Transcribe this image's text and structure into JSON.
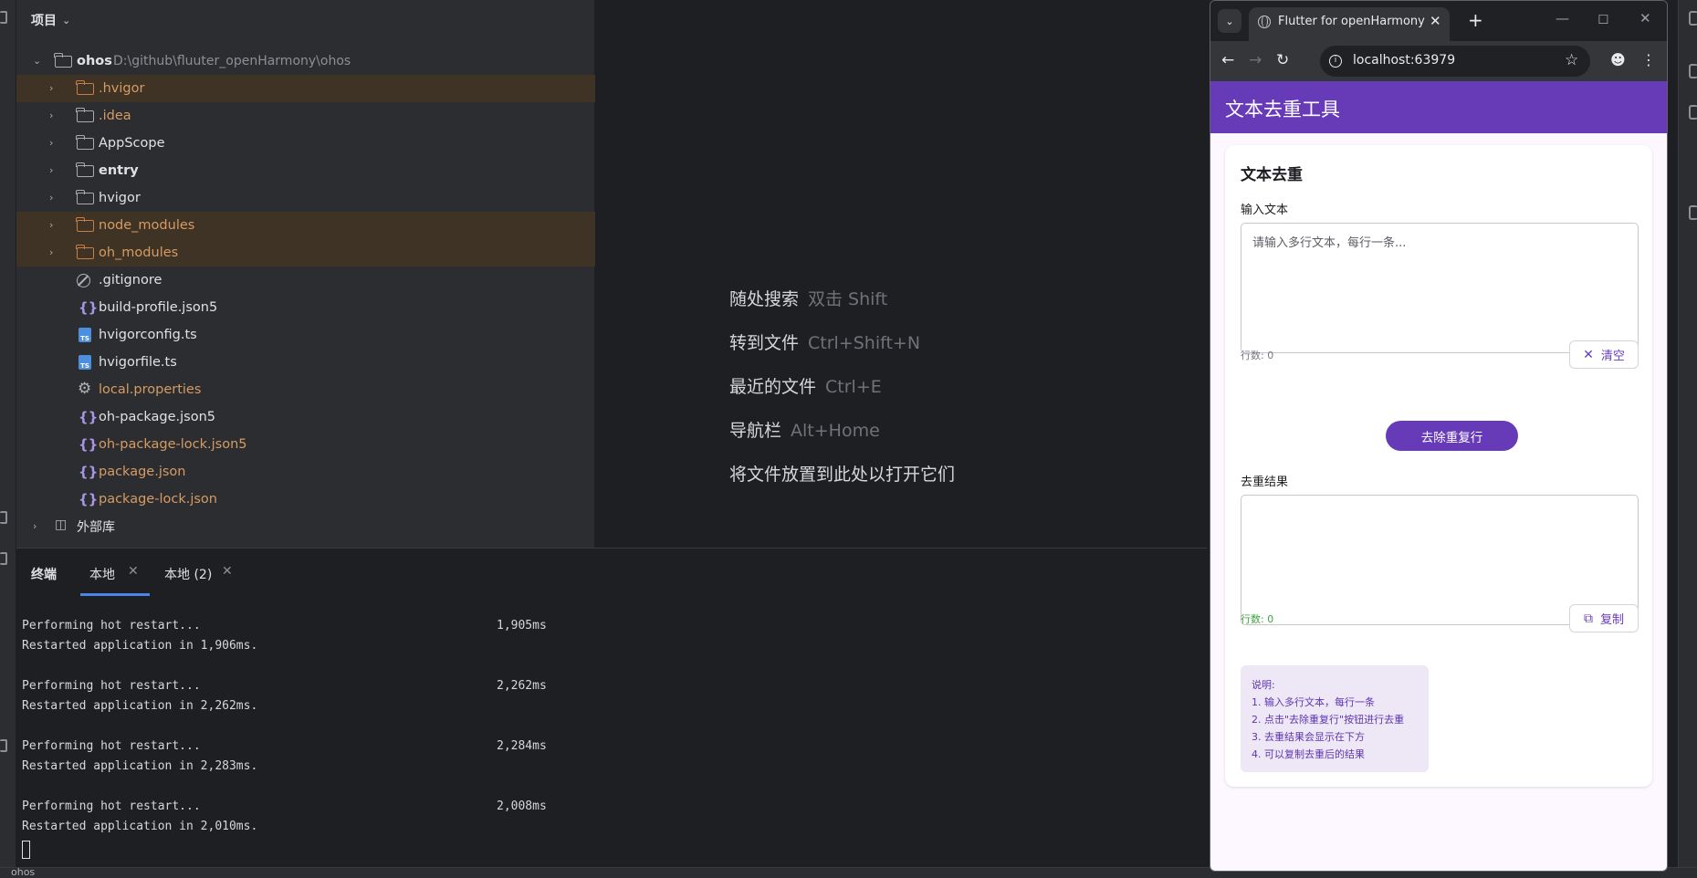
{
  "project": {
    "header": "项目",
    "root_name": "ohos",
    "root_path": "D:\\github\\fluuter_openHarmony\\ohos",
    "items": [
      {
        "label": ".hvigor",
        "type": "folder",
        "excluded": true
      },
      {
        "label": ".idea",
        "type": "folder-orange-text"
      },
      {
        "label": "AppScope",
        "type": "folder"
      },
      {
        "label": "entry",
        "type": "module"
      },
      {
        "label": "hvigor",
        "type": "folder"
      },
      {
        "label": "node_modules",
        "type": "folder",
        "excluded": true
      },
      {
        "label": "oh_modules",
        "type": "folder",
        "excluded": true
      },
      {
        "label": ".gitignore",
        "type": "ignore-file"
      },
      {
        "label": "build-profile.json5",
        "type": "json"
      },
      {
        "label": "hvigorconfig.ts",
        "type": "ts"
      },
      {
        "label": "hvigorfile.ts",
        "type": "ts"
      },
      {
        "label": "local.properties",
        "type": "properties"
      },
      {
        "label": "oh-package.json5",
        "type": "json"
      },
      {
        "label": "oh-package-lock.json5",
        "type": "json-orange"
      },
      {
        "label": "package.json",
        "type": "json-orange"
      },
      {
        "label": "package-lock.json",
        "type": "json-orange"
      }
    ],
    "external_libs": "外部库"
  },
  "editor_hints": [
    {
      "action": "随处搜索",
      "shortcut": "双击 Shift"
    },
    {
      "action": "转到文件",
      "shortcut": "Ctrl+Shift+N"
    },
    {
      "action": "最近的文件",
      "shortcut": "Ctrl+E"
    },
    {
      "action": "导航栏",
      "shortcut": "Alt+Home"
    },
    {
      "action": "将文件放置到此处以打开它们",
      "shortcut": ""
    }
  ],
  "terminal": {
    "title": "终端",
    "tabs": [
      "本地",
      "本地 (2)"
    ],
    "entries": [
      {
        "line1": "Performing hot restart...",
        "time": "1,905ms",
        "line2": "Restarted application in 1,906ms."
      },
      {
        "line1": "Performing hot restart...",
        "time": "2,262ms",
        "line2": "Restarted application in 2,262ms."
      },
      {
        "line1": "Performing hot restart...",
        "time": "2,284ms",
        "line2": "Restarted application in 2,283ms."
      },
      {
        "line1": "Performing hot restart...",
        "time": "2,008ms",
        "line2": "Restarted application in 2,010ms."
      }
    ]
  },
  "statusbar": {
    "project": "ohos"
  },
  "browser": {
    "tab_title": "Flutter for openHarmony",
    "url": "localhost:63979"
  },
  "app": {
    "appbar_title": "文本去重工具",
    "card_title": "文本去重",
    "input_label": "输入文本",
    "input_placeholder": "请输入多行文本，每行一条...",
    "input_count": "行数: 0",
    "clear_label": "清空",
    "dedupe_label": "去除重复行",
    "result_label": "去重结果",
    "result_count": "行数: 0",
    "copy_label": "复制",
    "notes": [
      "说明:",
      "1. 输入多行文本，每行一条",
      "2. 点击\"去除重复行\"按钮进行去重",
      "3. 去重结果会显示在下方",
      "4. 可以复制去重后的结果"
    ],
    "colors": {
      "primary": "#673ab7",
      "background": "#fdf7ff",
      "note_bg": "#ede7f6"
    }
  }
}
